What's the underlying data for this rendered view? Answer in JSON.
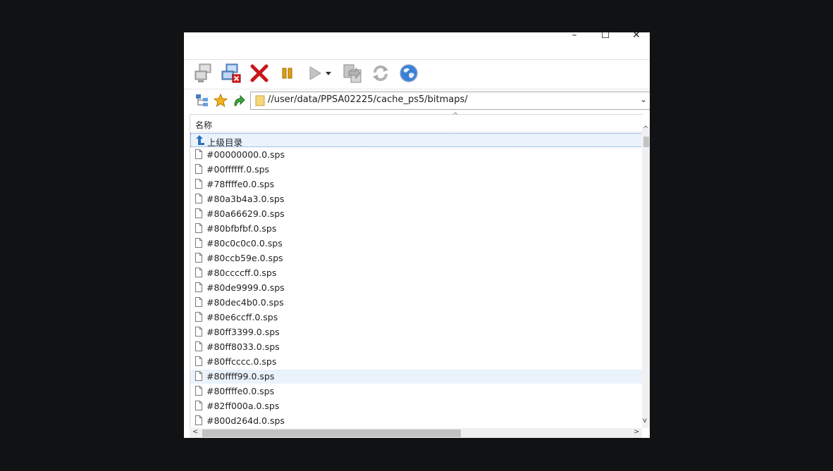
{
  "window": {
    "min_glyph": "–",
    "max_glyph": "☐",
    "close_glyph": "✕"
  },
  "toolbar": {
    "items": [
      "connect-icon",
      "disconnect-icon",
      "cancel-icon",
      "pause-icon",
      "play-icon",
      "play-menu-icon",
      "transfer-icon",
      "refresh-icon",
      "globe-icon"
    ]
  },
  "address": {
    "path": "//user/data/PPSA02225/cache_ps5/bitmaps/"
  },
  "list": {
    "column_name": "名称",
    "parent_label": "上级目录",
    "files": [
      "#00000000.0.sps",
      "#00ffffff.0.sps",
      "#78ffffe0.0.sps",
      "#80a3b4a3.0.sps",
      "#80a66629.0.sps",
      "#80bfbfbf.0.sps",
      "#80c0c0c0.0.sps",
      "#80ccb59e.0.sps",
      "#80ccccff.0.sps",
      "#80de9999.0.sps",
      "#80dec4b0.0.sps",
      "#80e6ccff.0.sps",
      "#80ff3399.0.sps",
      "#80ff8033.0.sps",
      "#80ffcccc.0.sps",
      "#80ffff99.0.sps",
      "#80ffffe0.0.sps",
      "#82ff000a.0.sps",
      "#800d264d.0.sps"
    ]
  },
  "colors": {
    "accent": "#5a8fd0",
    "selection": "#eaf3fc",
    "folder": "#f5d77a"
  }
}
